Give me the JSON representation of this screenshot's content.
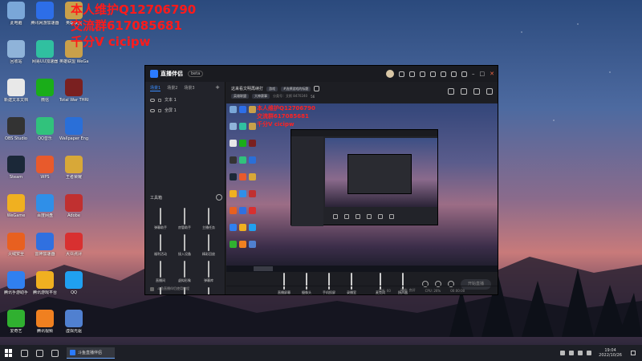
{
  "overlay": {
    "line1": "本人维护Q12706790",
    "line2": "交流群617085681",
    "line3": "千分V cicipw"
  },
  "desktop_icons": [
    {
      "label": "此电脑",
      "color": "#7aa7d8"
    },
    {
      "label": "腾讯网游加速器",
      "color": "#2d6ee8"
    },
    {
      "label": "英雄联盟",
      "color": "#c9a04a"
    },
    {
      "label": "回收站",
      "color": "#8fb3d9"
    },
    {
      "label": "网易UU加速器",
      "color": "#30c0a0"
    },
    {
      "label": "英雄联盟 WeGame版",
      "color": "#c9a04a"
    },
    {
      "label": "新建文本文档",
      "color": "#e8e8e8"
    },
    {
      "label": "微信",
      "color": "#1aad19"
    },
    {
      "label": "Total War THREE KI...",
      "color": "#7a2020"
    },
    {
      "label": "OBS Studio",
      "color": "#333333"
    },
    {
      "label": "QQ音乐",
      "color": "#31c27c"
    },
    {
      "label": "Wallpaper Engine",
      "color": "#2a6fd8"
    },
    {
      "label": "Steam",
      "color": "#1b2838"
    },
    {
      "label": "WPS",
      "color": "#e85a2c"
    },
    {
      "label": "王者荣耀",
      "color": "#d8a838"
    },
    {
      "label": "WeGame",
      "color": "#f0b020"
    },
    {
      "label": "百度网盘",
      "color": "#2f8fe8"
    },
    {
      "label": "Adobe",
      "color": "#c03030"
    },
    {
      "label": "火绒安全",
      "color": "#e86020"
    },
    {
      "label": "雷神加速器",
      "color": "#3070e0"
    },
    {
      "label": "大众点评",
      "color": "#d83030"
    },
    {
      "label": "腾讯手游助手",
      "color": "#3080f0"
    },
    {
      "label": "腾讯游戏平台",
      "color": "#f0b020"
    },
    {
      "label": "QQ",
      "color": "#20a0f0"
    },
    {
      "label": "爱奇艺",
      "color": "#30b030"
    },
    {
      "label": "腾讯视频",
      "color": "#f08020"
    },
    {
      "label": "虚拟光驱",
      "color": "#5080d0"
    }
  ],
  "app": {
    "logo_text": "直播伴侣",
    "version_badge": "beta",
    "left": {
      "tabs": [
        "场景1",
        "场景2",
        "场景3"
      ],
      "add_label": "+",
      "scenes": [
        "文本 1",
        "全屏 1"
      ],
      "tools_heading": "工具箱",
      "tools": [
        {
          "label": "弹幕助手"
        },
        {
          "label": "房管助手"
        },
        {
          "label": "主播任务"
        },
        {
          "label": "福利活动"
        },
        {
          "label": "接入设备"
        },
        {
          "label": "精彩回放"
        },
        {
          "label": "直播间"
        },
        {
          "label": "虚拟形象"
        },
        {
          "label": "弹幕库"
        },
        {
          "label": "录屏"
        },
        {
          "label": "PK"
        },
        {
          "label": "下载"
        }
      ],
      "footer": "斗鱼直播伴侣使用教程"
    },
    "room": {
      "title": "这来看文明再续打",
      "tag1": "游戏",
      "tag2": "#选择游戏的标题",
      "meta_left": "英雄联盟",
      "meta_mid": "大神赛事",
      "meta_room": "分类号：艾斯 8470240",
      "meta_heat": "56"
    },
    "preview_overlay": {
      "line1": "本人维护Q12706790",
      "line2": "交流群617085681",
      "line3": "千分V cicipw"
    },
    "bottom_tools": [
      {
        "label": "直播屏幕"
      },
      {
        "label": "摄像头"
      },
      {
        "label": "手机投屏"
      },
      {
        "label": "录播室"
      },
      {
        "label": "麦克风"
      },
      {
        "label": "扬声器"
      }
    ],
    "live_button": "开始直播",
    "status": {
      "fps": "FPS: 60",
      "net": "网络: 良好",
      "cpu": "CPU: 26%",
      "time": "00:00:00"
    }
  },
  "taskbar": {
    "active_task": "斗鱼直播伴侣",
    "time": "19:04",
    "date": "2022/10/26"
  }
}
